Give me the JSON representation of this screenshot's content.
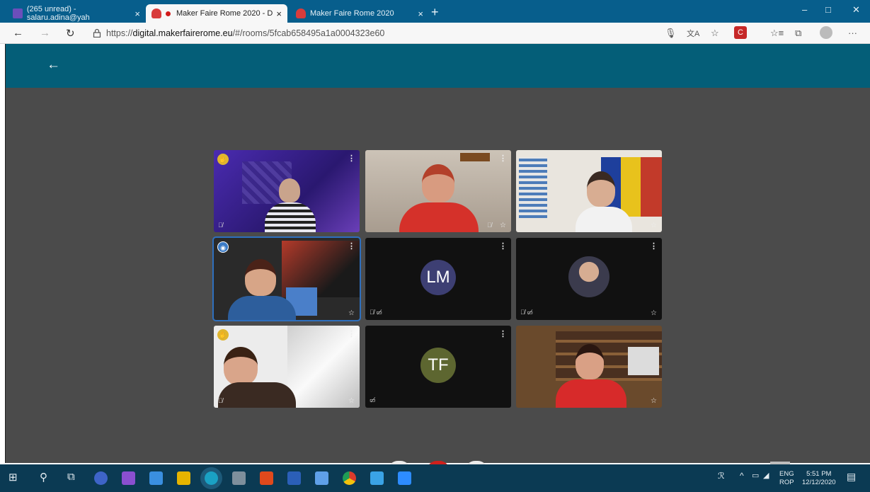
{
  "browser": {
    "tabs": [
      {
        "label": "(265 unread) - salaru.adina@yah",
        "active": false
      },
      {
        "label": "Maker Faire Rome 2020 - D",
        "active": true,
        "recording": true
      },
      {
        "label": "Maker Faire Rome 2020",
        "active": false
      }
    ],
    "tab_close": "×",
    "new_tab": "+",
    "window_controls": {
      "minimize": "–",
      "maximize": "□",
      "close": "✕"
    },
    "url_prefix": "https://",
    "url_domain": "digital.makerfairerome.eu",
    "url_path": "/#/rooms/5fcab658495a1a0004323e60",
    "nav": {
      "back": "←",
      "forward": "→",
      "refresh": "↻",
      "lock": "🔒"
    },
    "toolbar_icons": [
      "microphone-icon",
      "translate-icon",
      "favorite-icon",
      "extension-icon",
      "collections-icon",
      "favorites-bar-icon",
      "profile-icon",
      "more-icon"
    ],
    "more": "···"
  },
  "app": {
    "back": "←",
    "header_color": "#045e78",
    "stage_color": "#4b4b4b"
  },
  "participants": [
    {
      "type": "video",
      "badge": "hand",
      "mic_muted": true,
      "scene": "purple room"
    },
    {
      "type": "video",
      "mic_muted": true,
      "starred": false,
      "scene": "woman red hair"
    },
    {
      "type": "video",
      "scene": "woman with flag"
    },
    {
      "type": "video",
      "badge": "speaking",
      "active_speaker": true,
      "scene": "woman with poster"
    },
    {
      "type": "avatar",
      "initials": "LM",
      "avatar_color": "#3d3f73",
      "mic_muted": true,
      "cam_off": true
    },
    {
      "type": "photo",
      "mic_muted": true,
      "cam_off": true
    },
    {
      "type": "video",
      "badge": "hand",
      "mic_muted": true,
      "scene": "young man"
    },
    {
      "type": "avatar",
      "initials": "TF",
      "avatar_color": "#5d6630",
      "cam_off": true
    },
    {
      "type": "video",
      "scene": "woman in red jacket"
    }
  ],
  "taskbar": {
    "start": "⊞",
    "search": "⚲",
    "task_view": "⧉",
    "tray": {
      "language_1": "ENG",
      "language_2": "ROP",
      "time": "5:51 PM",
      "date": "12/12/2020",
      "chevron": "^",
      "people": "ℛ"
    }
  }
}
